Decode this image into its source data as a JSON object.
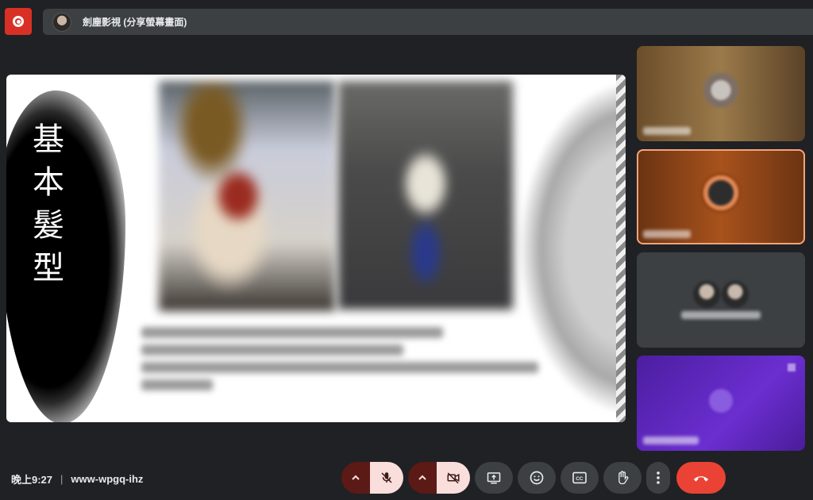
{
  "top_bar": {
    "presenter_label": "劍塵影視 (分享螢幕畫面)"
  },
  "slide": {
    "title_chars": [
      "基",
      "本",
      "髮",
      "型"
    ]
  },
  "bottom_bar": {
    "time": "晚上9:27",
    "separator": "|",
    "meeting_code": "www-wpgq-ihz"
  },
  "icons": {
    "record": "record-icon",
    "mic": "mic-off-icon",
    "camera": "camera-off-icon",
    "present": "present-screen-icon",
    "emoji": "emoji-icon",
    "captions": "captions-icon",
    "hand": "raise-hand-icon",
    "more": "more-options-icon",
    "end": "end-call-icon"
  },
  "colors": {
    "background": "#202124",
    "end_call": "#ea4335",
    "record": "#d93025",
    "muted_toggle": "#f9dedc"
  }
}
